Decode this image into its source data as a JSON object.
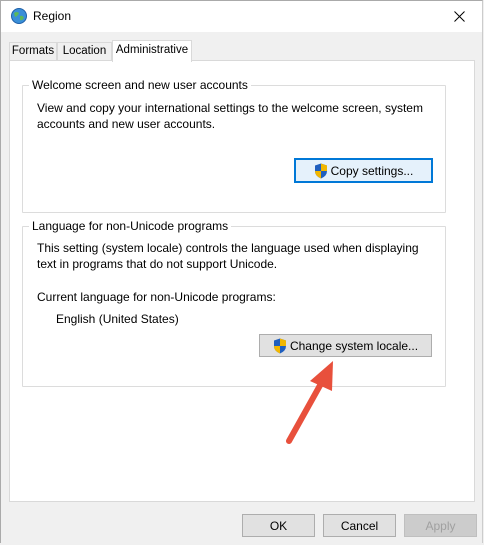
{
  "window": {
    "title": "Region"
  },
  "tabs": [
    {
      "label": "Formats"
    },
    {
      "label": "Location"
    },
    {
      "label": "Administrative"
    }
  ],
  "welcome_group": {
    "legend": "Welcome screen and new user accounts",
    "description": "View and copy your international settings to the welcome screen, system accounts and new user accounts.",
    "button": "Copy settings..."
  },
  "locale_group": {
    "legend": "Language for non-Unicode programs",
    "description": "This setting (system locale) controls the language used when displaying text in programs that do not support Unicode.",
    "current_label": "Current language for non-Unicode programs:",
    "current_value": "English (United States)",
    "button": "Change system locale..."
  },
  "footer": {
    "ok": "OK",
    "cancel": "Cancel",
    "apply": "Apply"
  },
  "colors": {
    "accent": "#0078d7",
    "annotation_arrow": "#e8503c",
    "shield_blue": "#1f5fbf",
    "shield_gold": "#f2b700"
  }
}
